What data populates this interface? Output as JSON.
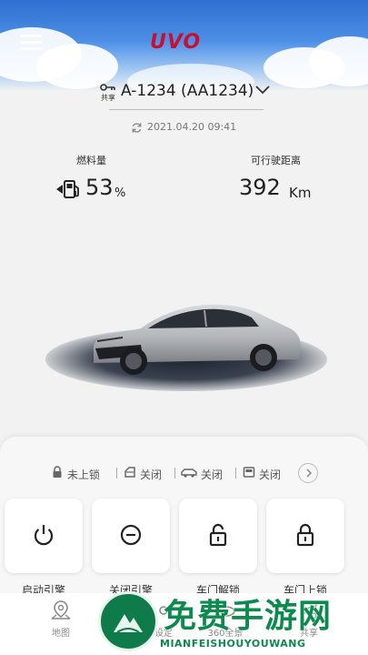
{
  "header": {
    "logo_text": "UVO"
  },
  "vehicle": {
    "share_label": "共享",
    "name": "A-1234 (AA1234)",
    "updated_at": "2021.04.20 09:41"
  },
  "metrics": {
    "fuel_label": "燃料量",
    "fuel_value": "53",
    "fuel_unit": "%",
    "range_label": "可行驶距离",
    "range_value": "392",
    "range_unit": "Km"
  },
  "status": [
    {
      "icon": "lock-icon",
      "text": "未上锁"
    },
    {
      "icon": "car-door-icon",
      "text": "关闭"
    },
    {
      "icon": "car-trunk-icon",
      "text": "关闭"
    },
    {
      "icon": "window-icon",
      "text": "关闭"
    }
  ],
  "controls": [
    {
      "icon": "power-icon",
      "label": "启动引擎"
    },
    {
      "icon": "stop-icon",
      "label": "关闭引擎"
    },
    {
      "icon": "unlock-icon",
      "label": "车门解锁"
    },
    {
      "icon": "lock-icon",
      "label": "车门上锁"
    }
  ],
  "tabs": [
    {
      "icon": "map-pin-icon",
      "label": "地图"
    },
    {
      "icon": "car-icon",
      "label": ""
    },
    {
      "icon": "settings-icon",
      "label": "设定"
    },
    {
      "icon": "view-360-icon",
      "label": "360全景"
    },
    {
      "icon": "share-icon",
      "label": "共享"
    }
  ],
  "watermark": {
    "title": "免费手游网",
    "subtitle": "MIANFEISHOUYOUWANG"
  },
  "colors": {
    "brand_red": "#c8102e",
    "sky_blue": "#2f6fd1",
    "watermark_green": "#0d8a4e"
  }
}
